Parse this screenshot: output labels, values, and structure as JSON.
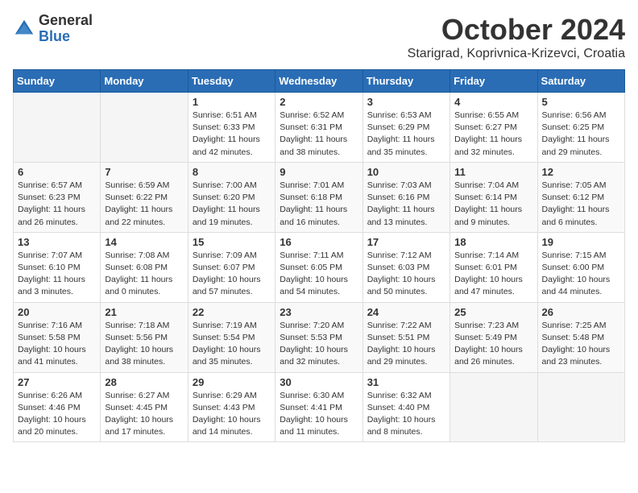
{
  "header": {
    "logo_general": "General",
    "logo_blue": "Blue",
    "month_title": "October 2024",
    "location": "Starigrad, Koprivnica-Krizevci, Croatia"
  },
  "days_of_week": [
    "Sunday",
    "Monday",
    "Tuesday",
    "Wednesday",
    "Thursday",
    "Friday",
    "Saturday"
  ],
  "weeks": [
    [
      {
        "day": "",
        "info": ""
      },
      {
        "day": "",
        "info": ""
      },
      {
        "day": "1",
        "info": "Sunrise: 6:51 AM\nSunset: 6:33 PM\nDaylight: 11 hours and 42 minutes."
      },
      {
        "day": "2",
        "info": "Sunrise: 6:52 AM\nSunset: 6:31 PM\nDaylight: 11 hours and 38 minutes."
      },
      {
        "day": "3",
        "info": "Sunrise: 6:53 AM\nSunset: 6:29 PM\nDaylight: 11 hours and 35 minutes."
      },
      {
        "day": "4",
        "info": "Sunrise: 6:55 AM\nSunset: 6:27 PM\nDaylight: 11 hours and 32 minutes."
      },
      {
        "day": "5",
        "info": "Sunrise: 6:56 AM\nSunset: 6:25 PM\nDaylight: 11 hours and 29 minutes."
      }
    ],
    [
      {
        "day": "6",
        "info": "Sunrise: 6:57 AM\nSunset: 6:23 PM\nDaylight: 11 hours and 26 minutes."
      },
      {
        "day": "7",
        "info": "Sunrise: 6:59 AM\nSunset: 6:22 PM\nDaylight: 11 hours and 22 minutes."
      },
      {
        "day": "8",
        "info": "Sunrise: 7:00 AM\nSunset: 6:20 PM\nDaylight: 11 hours and 19 minutes."
      },
      {
        "day": "9",
        "info": "Sunrise: 7:01 AM\nSunset: 6:18 PM\nDaylight: 11 hours and 16 minutes."
      },
      {
        "day": "10",
        "info": "Sunrise: 7:03 AM\nSunset: 6:16 PM\nDaylight: 11 hours and 13 minutes."
      },
      {
        "day": "11",
        "info": "Sunrise: 7:04 AM\nSunset: 6:14 PM\nDaylight: 11 hours and 9 minutes."
      },
      {
        "day": "12",
        "info": "Sunrise: 7:05 AM\nSunset: 6:12 PM\nDaylight: 11 hours and 6 minutes."
      }
    ],
    [
      {
        "day": "13",
        "info": "Sunrise: 7:07 AM\nSunset: 6:10 PM\nDaylight: 11 hours and 3 minutes."
      },
      {
        "day": "14",
        "info": "Sunrise: 7:08 AM\nSunset: 6:08 PM\nDaylight: 11 hours and 0 minutes."
      },
      {
        "day": "15",
        "info": "Sunrise: 7:09 AM\nSunset: 6:07 PM\nDaylight: 10 hours and 57 minutes."
      },
      {
        "day": "16",
        "info": "Sunrise: 7:11 AM\nSunset: 6:05 PM\nDaylight: 10 hours and 54 minutes."
      },
      {
        "day": "17",
        "info": "Sunrise: 7:12 AM\nSunset: 6:03 PM\nDaylight: 10 hours and 50 minutes."
      },
      {
        "day": "18",
        "info": "Sunrise: 7:14 AM\nSunset: 6:01 PM\nDaylight: 10 hours and 47 minutes."
      },
      {
        "day": "19",
        "info": "Sunrise: 7:15 AM\nSunset: 6:00 PM\nDaylight: 10 hours and 44 minutes."
      }
    ],
    [
      {
        "day": "20",
        "info": "Sunrise: 7:16 AM\nSunset: 5:58 PM\nDaylight: 10 hours and 41 minutes."
      },
      {
        "day": "21",
        "info": "Sunrise: 7:18 AM\nSunset: 5:56 PM\nDaylight: 10 hours and 38 minutes."
      },
      {
        "day": "22",
        "info": "Sunrise: 7:19 AM\nSunset: 5:54 PM\nDaylight: 10 hours and 35 minutes."
      },
      {
        "day": "23",
        "info": "Sunrise: 7:20 AM\nSunset: 5:53 PM\nDaylight: 10 hours and 32 minutes."
      },
      {
        "day": "24",
        "info": "Sunrise: 7:22 AM\nSunset: 5:51 PM\nDaylight: 10 hours and 29 minutes."
      },
      {
        "day": "25",
        "info": "Sunrise: 7:23 AM\nSunset: 5:49 PM\nDaylight: 10 hours and 26 minutes."
      },
      {
        "day": "26",
        "info": "Sunrise: 7:25 AM\nSunset: 5:48 PM\nDaylight: 10 hours and 23 minutes."
      }
    ],
    [
      {
        "day": "27",
        "info": "Sunrise: 6:26 AM\nSunset: 4:46 PM\nDaylight: 10 hours and 20 minutes."
      },
      {
        "day": "28",
        "info": "Sunrise: 6:27 AM\nSunset: 4:45 PM\nDaylight: 10 hours and 17 minutes."
      },
      {
        "day": "29",
        "info": "Sunrise: 6:29 AM\nSunset: 4:43 PM\nDaylight: 10 hours and 14 minutes."
      },
      {
        "day": "30",
        "info": "Sunrise: 6:30 AM\nSunset: 4:41 PM\nDaylight: 10 hours and 11 minutes."
      },
      {
        "day": "31",
        "info": "Sunrise: 6:32 AM\nSunset: 4:40 PM\nDaylight: 10 hours and 8 minutes."
      },
      {
        "day": "",
        "info": ""
      },
      {
        "day": "",
        "info": ""
      }
    ]
  ]
}
